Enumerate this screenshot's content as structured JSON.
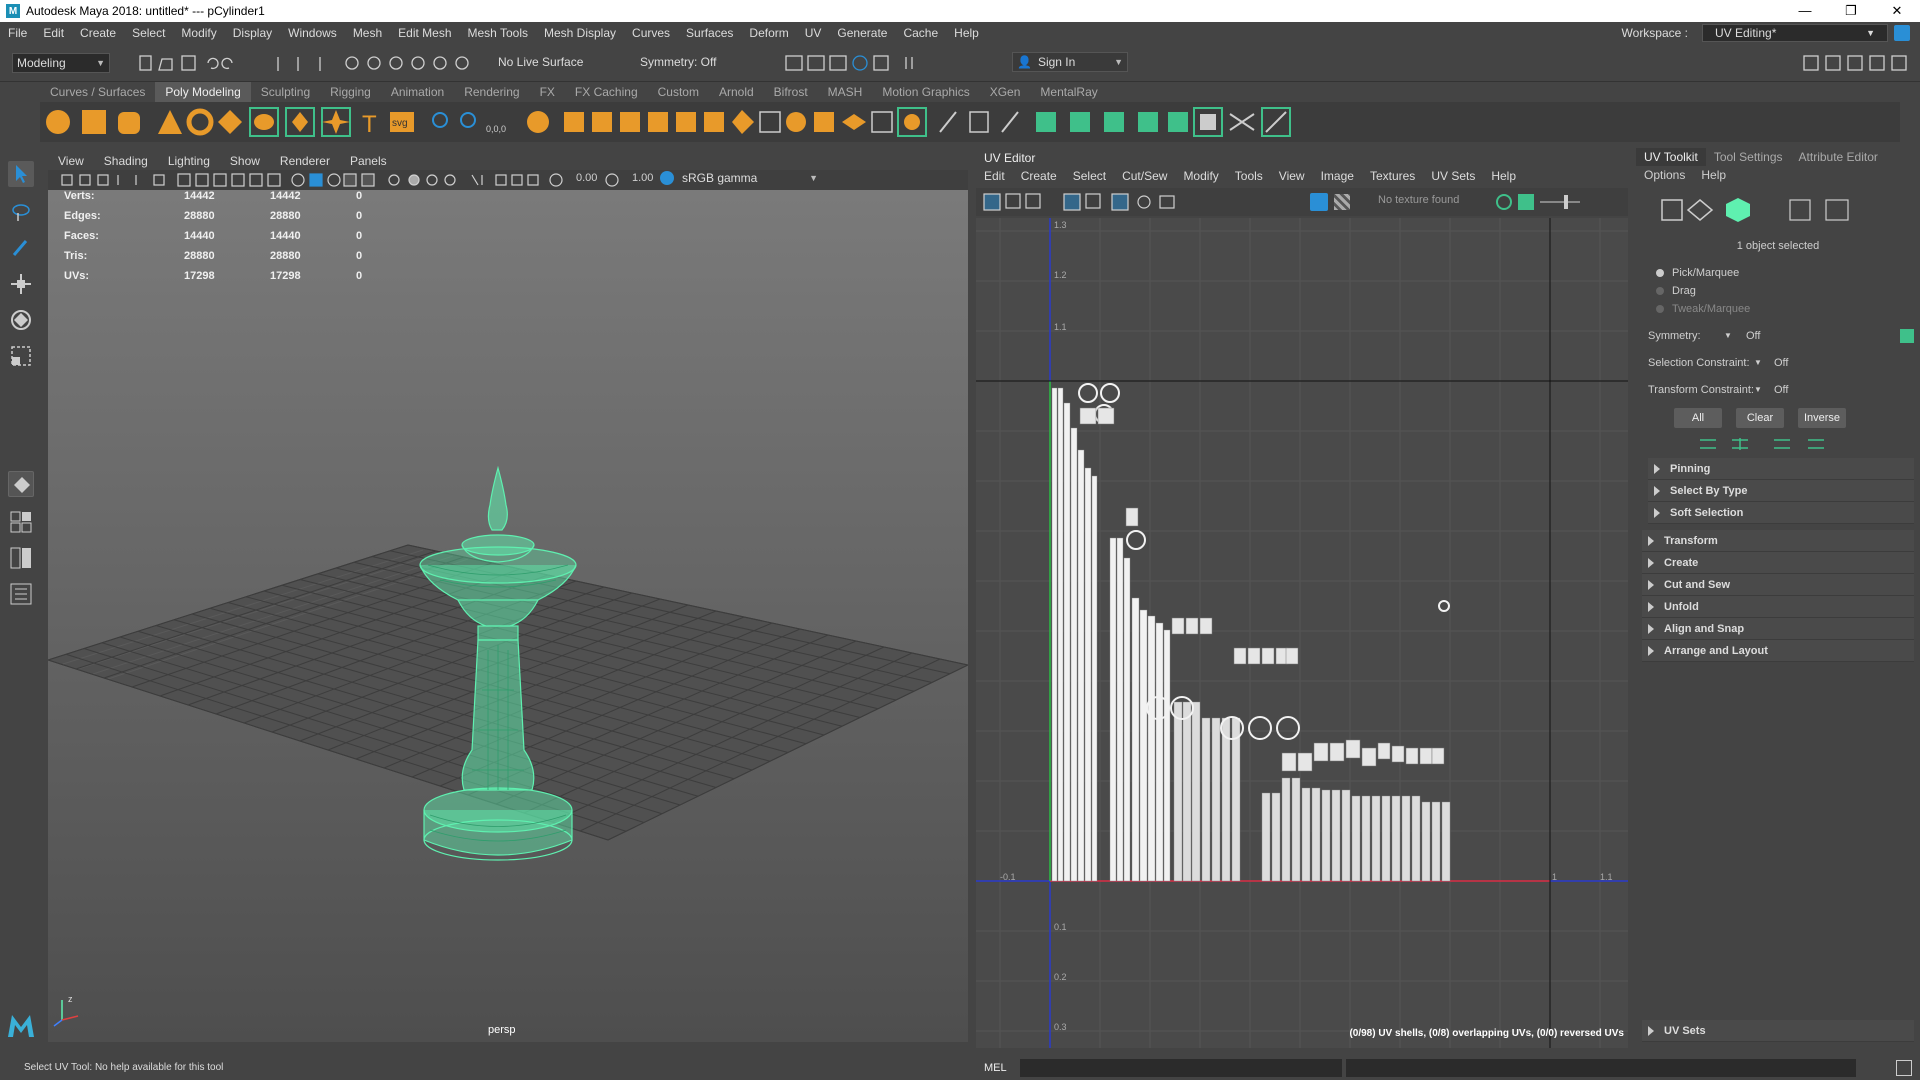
{
  "window": {
    "title": "Autodesk Maya 2018: untitled*   ---   pCylinder1",
    "controls": [
      "—",
      "❐",
      "✕"
    ]
  },
  "menubar": {
    "items": [
      "File",
      "Edit",
      "Create",
      "Select",
      "Modify",
      "Display",
      "Windows",
      "Mesh",
      "Edit Mesh",
      "Mesh Tools",
      "Mesh Display",
      "Curves",
      "Surfaces",
      "Deform",
      "UV",
      "Generate",
      "Cache",
      "Help"
    ],
    "workspace_label": "Workspace :",
    "workspace_value": "UV Editing*"
  },
  "statusline": {
    "mode": "Modeling",
    "live_surface": "No Live Surface",
    "symmetry": "Symmetry: Off",
    "sign_in": "Sign In"
  },
  "shelf": {
    "tabs": [
      "Curves / Surfaces",
      "Poly Modeling",
      "Sculpting",
      "Rigging",
      "Animation",
      "Rendering",
      "FX",
      "FX Caching",
      "Custom",
      "Arnold",
      "Bifrost",
      "MASH",
      "Motion Graphics",
      "XGen",
      "MentalRay"
    ],
    "active_tab": "Poly Modeling",
    "text_icon": "T",
    "svg_icon": "svg",
    "zero_icon": "0,0,0"
  },
  "viewport": {
    "menu": [
      "View",
      "Shading",
      "Lighting",
      "Show",
      "Renderer",
      "Panels"
    ],
    "exposure": "0.00",
    "gamma": "1.00",
    "colorspace": "sRGB gamma",
    "camera": "persp",
    "hud": [
      {
        "label": "Verts:",
        "a": "14442",
        "b": "14442",
        "c": "0"
      },
      {
        "label": "Edges:",
        "a": "28880",
        "b": "28880",
        "c": "0"
      },
      {
        "label": "Faces:",
        "a": "14440",
        "b": "14440",
        "c": "0"
      },
      {
        "label": "Tris:",
        "a": "28880",
        "b": "28880",
        "c": "0"
      },
      {
        "label": "UVs:",
        "a": "17298",
        "b": "17298",
        "c": "0"
      }
    ],
    "model_color": "#5ff0b0",
    "axis_label": "z"
  },
  "uv_editor": {
    "title": "UV Editor",
    "menu": [
      "Edit",
      "Create",
      "Select",
      "Cut/Sew",
      "Modify",
      "Tools",
      "View",
      "Image",
      "Textures",
      "UV Sets",
      "Help"
    ],
    "no_texture": "No texture found",
    "tick_labels": {
      "v": [
        "1.3",
        "1.2",
        "1.1",
        "0.1",
        "0.2",
        "0.3"
      ],
      "u": [
        "-0.1",
        "1",
        "1.1"
      ]
    },
    "stats": "(0/98) UV shells, (0/8) overlapping UVs, (0/0) reversed UVs"
  },
  "uv_toolkit": {
    "tabs": [
      "UV Toolkit",
      "Tool Settings",
      "Attribute Editor"
    ],
    "sub_menu": [
      "Options",
      "Help"
    ],
    "selected_text": "1 object selected",
    "modes": [
      "Pick/Marquee",
      "Drag",
      "Tweak/Marquee"
    ],
    "symmetry_label": "Symmetry:",
    "symmetry_value": "Off",
    "selection_constraint_label": "Selection Constraint:",
    "selection_constraint_value": "Off",
    "transform_constraint_label": "Transform Constraint:",
    "transform_constraint_value": "Off",
    "buttons": [
      "All",
      "Clear",
      "Inverse"
    ],
    "sub_sections": [
      "Pinning",
      "Select By Type",
      "Soft Selection"
    ],
    "sections": [
      "Transform",
      "Create",
      "Cut and Sew",
      "Unfold",
      "Align and Snap",
      "Arrange and Layout"
    ],
    "uv_sets": "UV Sets"
  },
  "bottom": {
    "help_line": "Select UV Tool: No help available for this tool",
    "mel_label": "MEL"
  },
  "colors": {
    "accent": "#2a8fd6",
    "shelf_orange": "#e89a2a",
    "shelf_green": "#3fc08a"
  }
}
